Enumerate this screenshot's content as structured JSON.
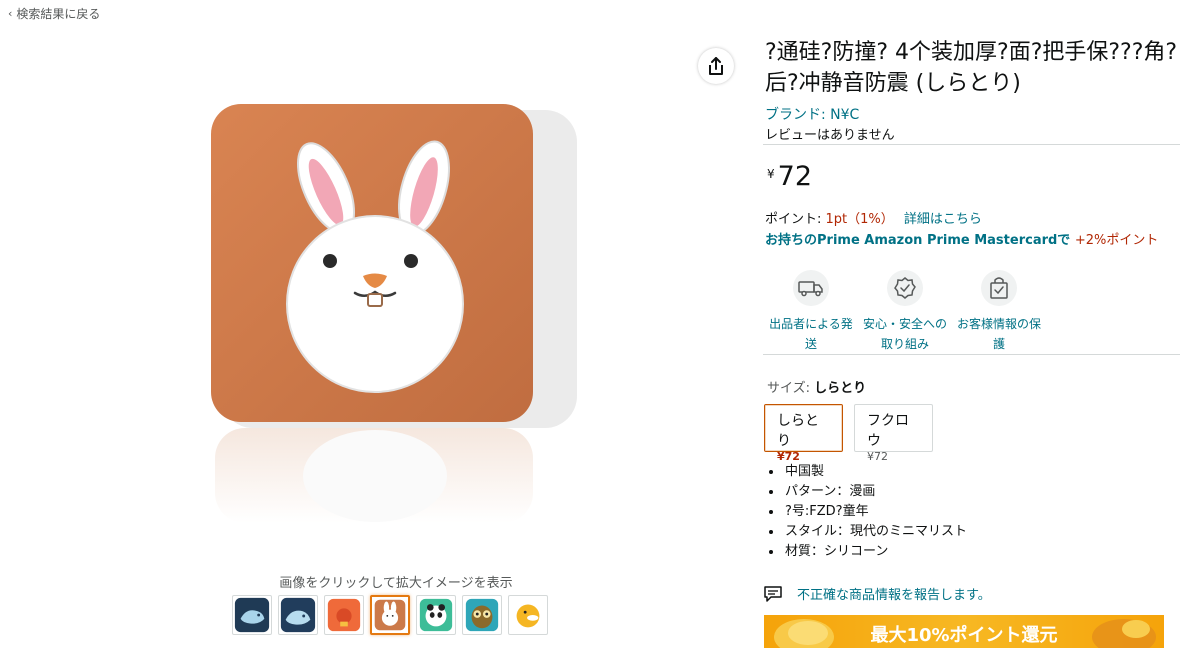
{
  "nav": {
    "back_label": "検索結果に戻る"
  },
  "gallery": {
    "zoom_caption": "画像をクリックして拡大イメージを表示",
    "thumbnails": [
      {
        "icon": "whale-icon"
      },
      {
        "icon": "whale-icon"
      },
      {
        "icon": "chick-icon"
      },
      {
        "icon": "rabbit-icon",
        "selected": true
      },
      {
        "icon": "panda-icon"
      },
      {
        "icon": "owl-icon"
      },
      {
        "icon": "duck-icon"
      }
    ]
  },
  "product": {
    "title": "?通硅?防撞? 4个装加厚?面?把手保???角?后?冲静音防震 (しらとり)",
    "brand": "ブランド: N¥C",
    "reviews": "レビューはありません",
    "price_symbol": "¥",
    "price": "72",
    "points_label": "ポイント: ",
    "points_value": "1pt（1%）",
    "points_details": "詳細はこちら",
    "card_offer": "お持ちのPrime Amazon Prime Mastercardで",
    "card_bonus": "+2%ポイント"
  },
  "features": [
    {
      "icon": "truck-icon",
      "label": "出品者による発送"
    },
    {
      "icon": "badge-check-icon",
      "label": "安心・安全への取り組み"
    },
    {
      "icon": "lock-bag-icon",
      "label": "お客様情報の保護"
    }
  ],
  "variations": {
    "label": "サイズ: ",
    "selected": "しらとり",
    "options": [
      {
        "name": "しらとり",
        "price": "¥72"
      },
      {
        "name": "フクロウ",
        "price": "¥72"
      }
    ]
  },
  "bullets": [
    "中国製",
    "パターン：漫画",
    "?号:FZD?童年",
    "スタイル：現代のミニマリスト",
    "材質：シリコーン"
  ],
  "report": {
    "label": "不正確な商品情報を報告します。",
    "icon": "report-comment-icon"
  },
  "promo": {
    "text": "最大10%ポイント還元"
  },
  "colors": {
    "accent": "#007185",
    "price_red": "#b12704",
    "selected_border": "#e47911",
    "product_orange": "#cc7a4a"
  }
}
